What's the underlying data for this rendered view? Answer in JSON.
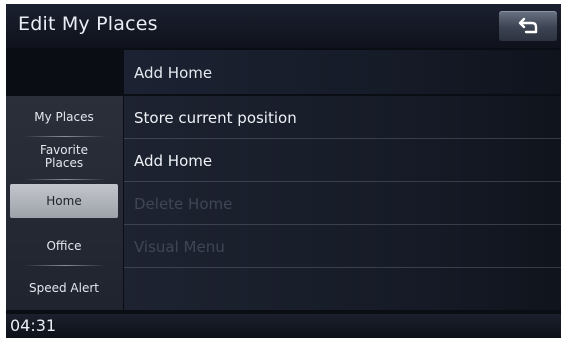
{
  "window": {
    "title": "Edit My Places",
    "back_icon": "back-arrow-icon"
  },
  "header": {
    "label": "Add Home"
  },
  "sidebar": {
    "items": [
      {
        "label": "My Places",
        "selected": false
      },
      {
        "label_line1": "Favorite",
        "label_line2": "Places",
        "selected": false
      },
      {
        "label": "Home",
        "selected": true
      },
      {
        "label": "Office",
        "selected": false
      },
      {
        "label": "Speed Alert",
        "selected": false
      }
    ]
  },
  "list": {
    "items": [
      {
        "label": "Store current position",
        "enabled": true
      },
      {
        "label": "Add Home",
        "enabled": true
      },
      {
        "label": "Delete Home",
        "enabled": false
      },
      {
        "label": "Visual Menu",
        "enabled": false
      }
    ]
  },
  "status": {
    "time": "04:31"
  },
  "colors": {
    "selected_bg": "#b4b8bf",
    "disabled_text": "#3f4656"
  }
}
